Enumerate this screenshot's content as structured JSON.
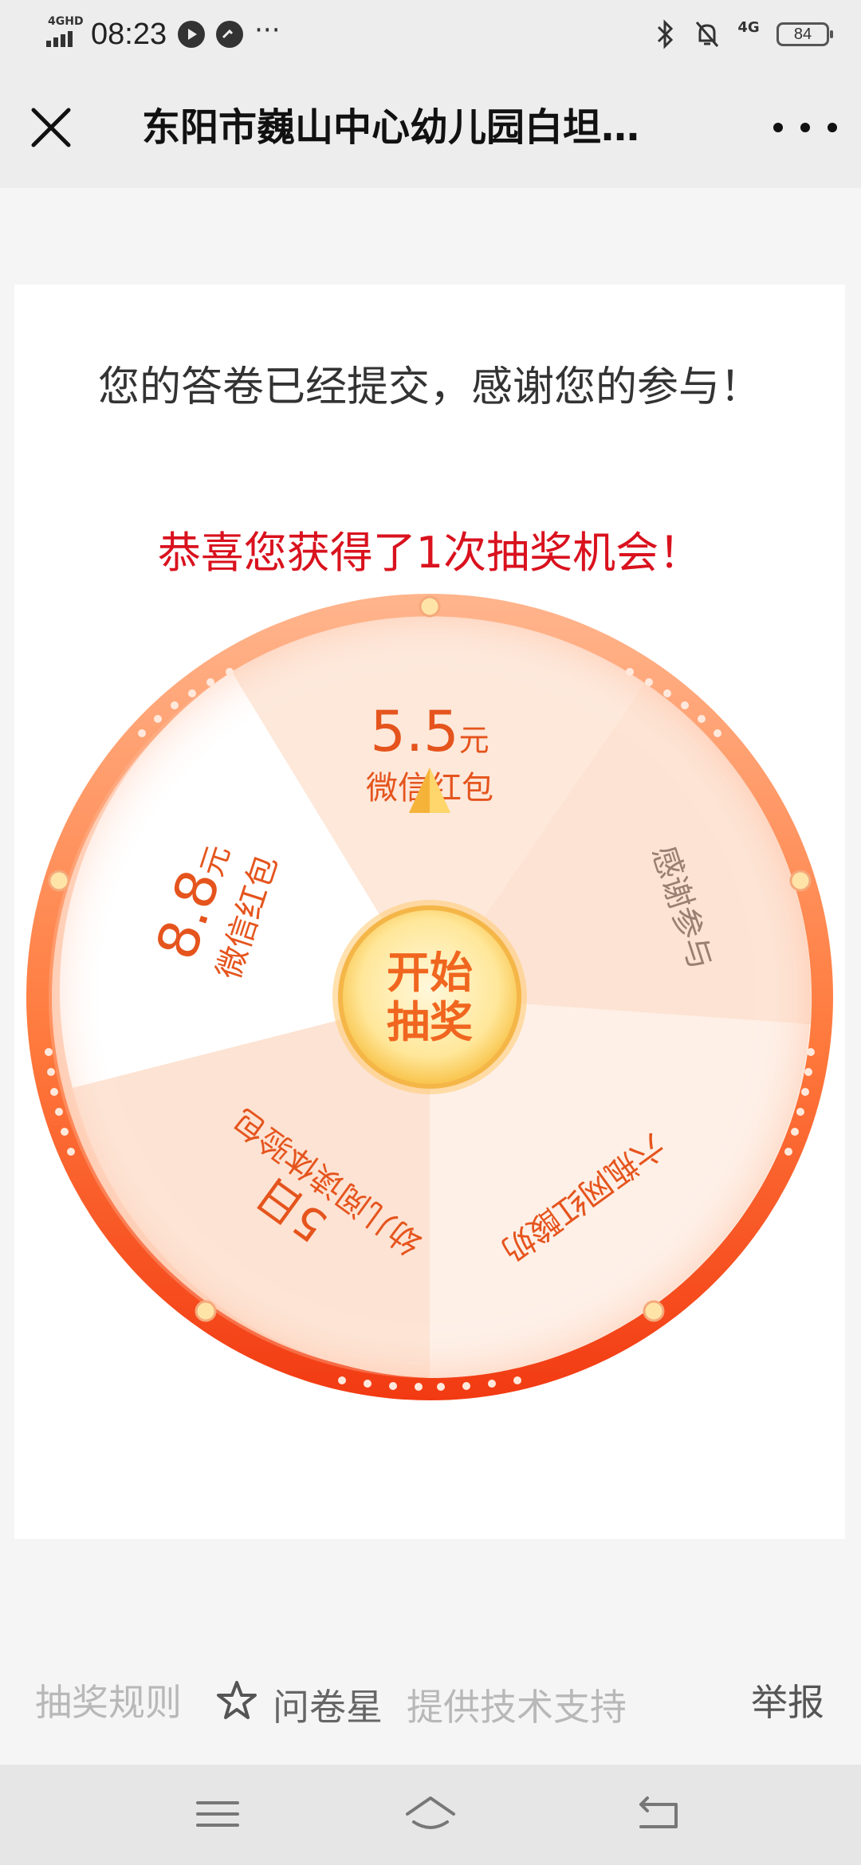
{
  "status_bar": {
    "network": "4GHD",
    "time": "08:23",
    "dots": "···",
    "right_network": "4G",
    "battery": "84"
  },
  "header": {
    "title": "东阳市巍山中心幼儿园白坦…"
  },
  "card": {
    "thanks_text": "您的答卷已经提交，感谢您的参与！",
    "congrats_text": "恭喜您获得了1次抽奖机会！"
  },
  "wheel": {
    "prizes": [
      {
        "amount": "5.5",
        "unit": "元",
        "desc": "微信红包"
      },
      {
        "desc": "感谢参与"
      },
      {
        "desc": "六瓶网红酸奶"
      },
      {
        "amount": "5日",
        "desc": "幼儿阅读体验包"
      },
      {
        "amount": "8.8",
        "unit": "元",
        "desc": "微信红包"
      }
    ],
    "start_label_1": "开始",
    "start_label_2": "抽奖"
  },
  "footer": {
    "rules": "抽奖规则",
    "brand": "问卷星",
    "support": "提供技术支持",
    "report": "举报"
  },
  "colors": {
    "accent_red": "#d9121e",
    "wheel_orange": "#ff6a2b",
    "prize_text": "#e5541d"
  }
}
